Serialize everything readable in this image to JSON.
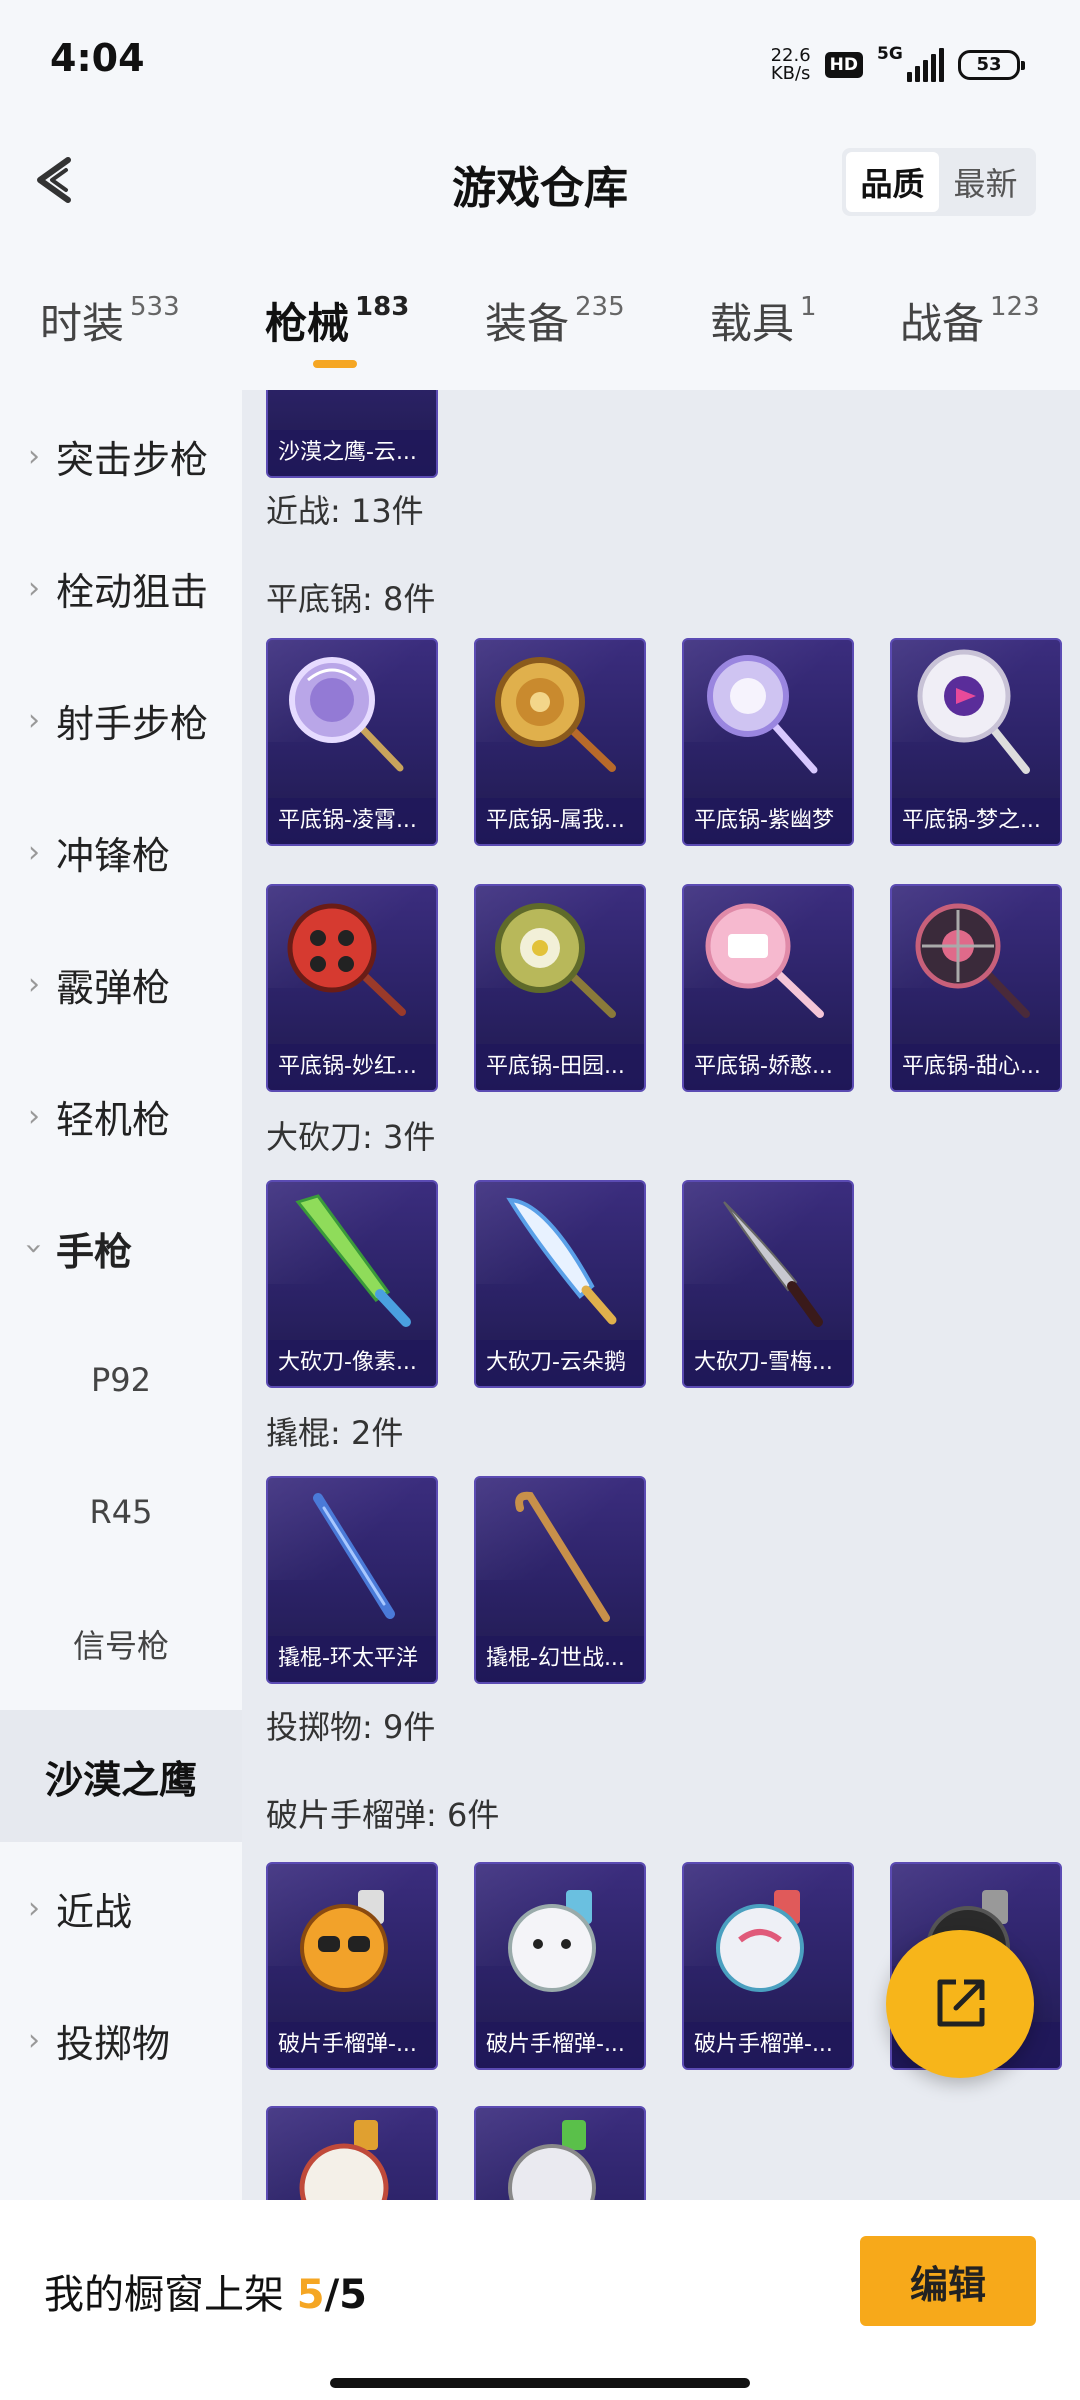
{
  "status": {
    "time": "4:04",
    "net_speed_value": "22.6",
    "net_speed_unit": "KB/s",
    "hd": "HD",
    "network": "5G",
    "battery": "53"
  },
  "header": {
    "title": "游戏仓库",
    "sort_options": [
      "品质",
      "最新"
    ],
    "sort_active": "品质"
  },
  "tabs": [
    {
      "name": "时装",
      "count": "533"
    },
    {
      "name": "枪械",
      "count": "183"
    },
    {
      "name": "装备",
      "count": "235"
    },
    {
      "name": "载具",
      "count": "1"
    },
    {
      "name": "战备",
      "count": "123"
    }
  ],
  "active_tab": "枪械",
  "sidebar": [
    {
      "label": "突击步枪"
    },
    {
      "label": "栓动狙击"
    },
    {
      "label": "射手步枪"
    },
    {
      "label": "冲锋枪"
    },
    {
      "label": "霰弹枪"
    },
    {
      "label": "轻机枪"
    },
    {
      "label": "手枪"
    },
    {
      "label": "P92"
    },
    {
      "label": "R45"
    },
    {
      "label": "信号枪"
    },
    {
      "label": "沙漠之鹰"
    },
    {
      "label": "近战"
    },
    {
      "label": "投掷物"
    }
  ],
  "sidebar_selected": "沙漠之鹰",
  "content": {
    "top_card_label": "沙漠之鹰-云...",
    "melee_header": "近战: 13件",
    "pan_header": "平底锅: 8件",
    "pans": [
      "平底锅-凌霄...",
      "平底锅-属我...",
      "平底锅-紫幽梦",
      "平底锅-梦之...",
      "平底锅-妙红...",
      "平底锅-田园...",
      "平底锅-娇憨...",
      "平底锅-甜心..."
    ],
    "machete_header": "大砍刀: 3件",
    "machetes": [
      "大砍刀-像素...",
      "大砍刀-云朵鹅",
      "大砍刀-雪梅..."
    ],
    "crowbar_header": "撬棍: 2件",
    "crowbars": [
      "撬棍-环太平洋",
      "撬棍-幻世战..."
    ],
    "throw_header": "投掷物: 9件",
    "frag_header": "破片手榴弹: 6件",
    "frags": [
      "破片手榴弹-...",
      "破片手榴弹-...",
      "破片手榴弹-...",
      ""
    ]
  },
  "footer": {
    "label": "我的橱窗上架",
    "current": "5",
    "total": "/5",
    "edit": "编辑"
  },
  "colors": {
    "accent": "#f5a623",
    "card_bg": "#2b2266",
    "fab": "#f7b51a"
  },
  "icons": {
    "back": "chevron-left-icon",
    "fab": "share-external-icon",
    "chevron": "chevron-right-icon"
  }
}
